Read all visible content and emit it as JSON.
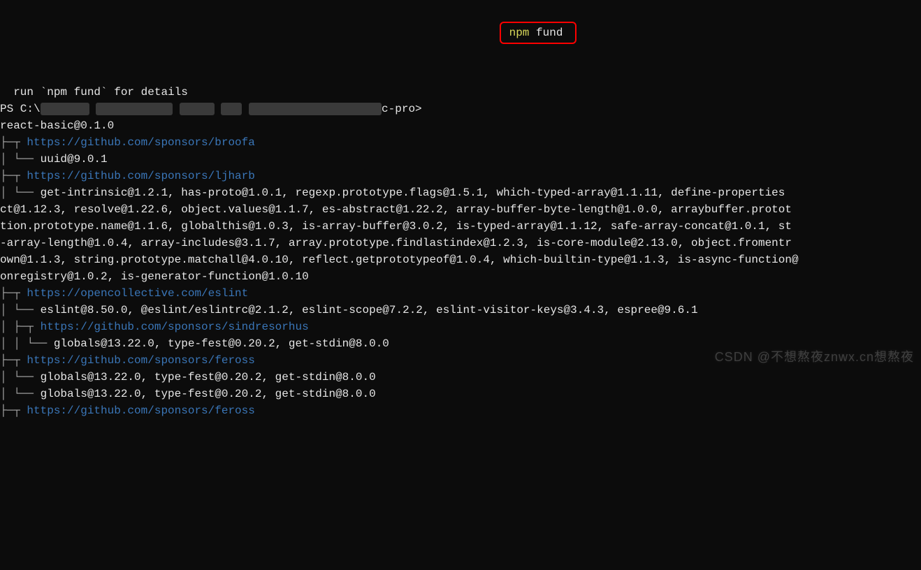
{
  "lines": {
    "details": "  run `npm fund` for details",
    "prompt_prefix": "PS C:\\",
    "prompt_suffix": "c-pro>",
    "command": " npm ",
    "command_arg": "fund",
    "root": "react-basic@0.1.0",
    "sponsor1": "https://github.com/sponsors/broofa",
    "sponsor1_pkgs": "uuid@9.0.1",
    "sponsor2": "https://github.com/sponsors/ljharb",
    "sponsor2_pkgs_1": "get-intrinsic@1.2.1, has-proto@1.0.1, regexp.prototype.flags@1.5.1, which-typed-array@1.1.11, define-properties",
    "sponsor2_pkgs_2": "ct@1.12.3, resolve@1.22.6, object.values@1.1.7, es-abstract@1.22.2, array-buffer-byte-length@1.0.0, arraybuffer.protot",
    "sponsor2_pkgs_3": "tion.prototype.name@1.1.6, globalthis@1.0.3, is-array-buffer@3.0.2, is-typed-array@1.1.12, safe-array-concat@1.0.1, st",
    "sponsor2_pkgs_4": "-array-length@1.0.4, array-includes@3.1.7, array.prototype.findlastindex@1.2.3, is-core-module@2.13.0, object.fromentr",
    "sponsor2_pkgs_5": "own@1.1.3, string.prototype.matchall@4.0.10, reflect.getprototypeof@1.0.4, which-builtin-type@1.1.3, is-async-function@",
    "sponsor2_pkgs_6": "onregistry@1.0.2, is-generator-function@1.0.10",
    "sponsor3": "https://opencollective.com/eslint",
    "sponsor3_pkgs": "eslint@8.50.0, @eslint/eslintrc@2.1.2, eslint-scope@7.2.2, eslint-visitor-keys@3.4.3, espree@9.6.1",
    "sponsor4": "https://github.com/sponsors/sindresorhus",
    "sponsor4_pkgs": "globals@13.22.0, type-fest@0.20.2, get-stdin@8.0.0",
    "sponsor5": "https://github.com/sponsors/feross",
    "sponsor5_pkgs_1": "globals@13.22.0, type-fest@0.20.2, get-stdin@8.0.0",
    "sponsor5_pkgs_2": "globals@13.22.0, type-fest@0.20.2, get-stdin@8.0.0",
    "sponsor6": "https://github.com/sponsors/feross"
  },
  "tree": {
    "branch": "├─┬ ",
    "branch_end": "│ └── ",
    "pipe": "│   ",
    "sub_branch": "│ ├─┬ ",
    "sub_end": "│ │ └── ",
    "sub_pipe": "│ │   "
  },
  "watermark": "CSDN @不想熬夜znwx.cn想熬夜"
}
